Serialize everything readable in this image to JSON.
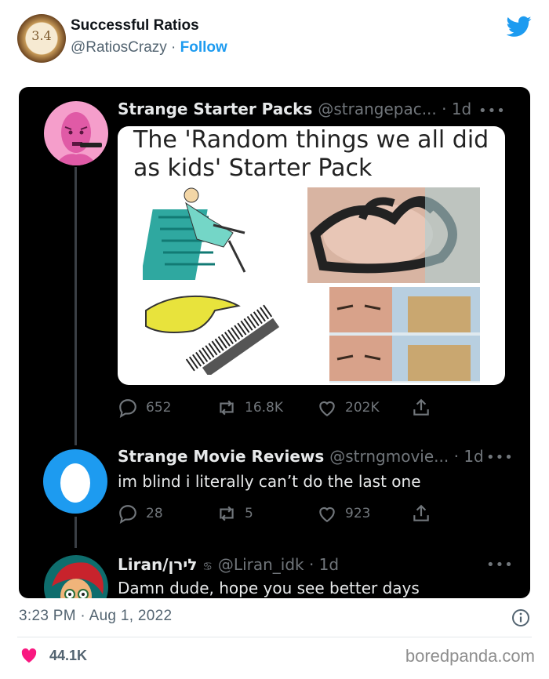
{
  "embed": {
    "account_name": "Successful Ratios",
    "handle": "@RatiosCrazy",
    "separator": " · ",
    "follow_label": "Follow",
    "avatar_text": "3.4",
    "accent_color": "#1d9bf0"
  },
  "thread": {
    "tweet1": {
      "name": "Strange Starter Packs",
      "meta": "@strangepac... · 1d",
      "menu": "•••",
      "image_title": "The 'Random things we all did as kids' Starter Pack",
      "replies": "652",
      "retweets": "16.8K",
      "likes": "202K"
    },
    "tweet2": {
      "name": "Strange Movie Reviews",
      "meta": "@strngmovie... · 1d",
      "menu": "•••",
      "text": "im blind i literally can’t do the last one",
      "replies": "28",
      "retweets": "5",
      "likes": "923"
    },
    "tweet3": {
      "name": "Liran/לירן",
      "badge": "♋",
      "meta": "@Liran_idk · 1d",
      "menu": "•••",
      "text": "Damn dude, hope you see better days"
    }
  },
  "footer": {
    "timestamp": "3:23 PM · Aug 1, 2022",
    "like_count": "44.1K",
    "like_color": "#f91880",
    "watermark": "boredpanda.com"
  }
}
